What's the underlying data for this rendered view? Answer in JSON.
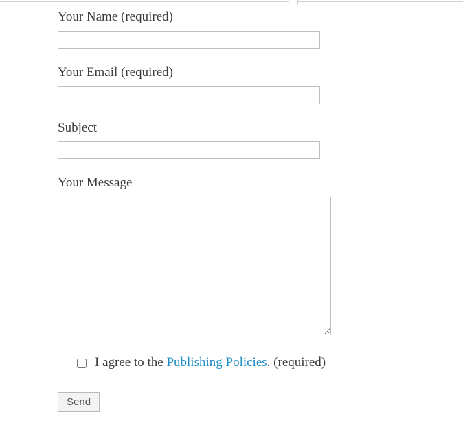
{
  "form": {
    "name": {
      "label": "Your Name (required)",
      "value": ""
    },
    "email": {
      "label": "Your Email (required)",
      "value": ""
    },
    "subject": {
      "label": "Subject",
      "value": ""
    },
    "message": {
      "label": "Your Message",
      "value": ""
    },
    "agree": {
      "prefix": "I agree to the ",
      "link_text": "Publishing Policies",
      "suffix": ". (required)",
      "checked": false
    },
    "submit_label": "Send"
  }
}
